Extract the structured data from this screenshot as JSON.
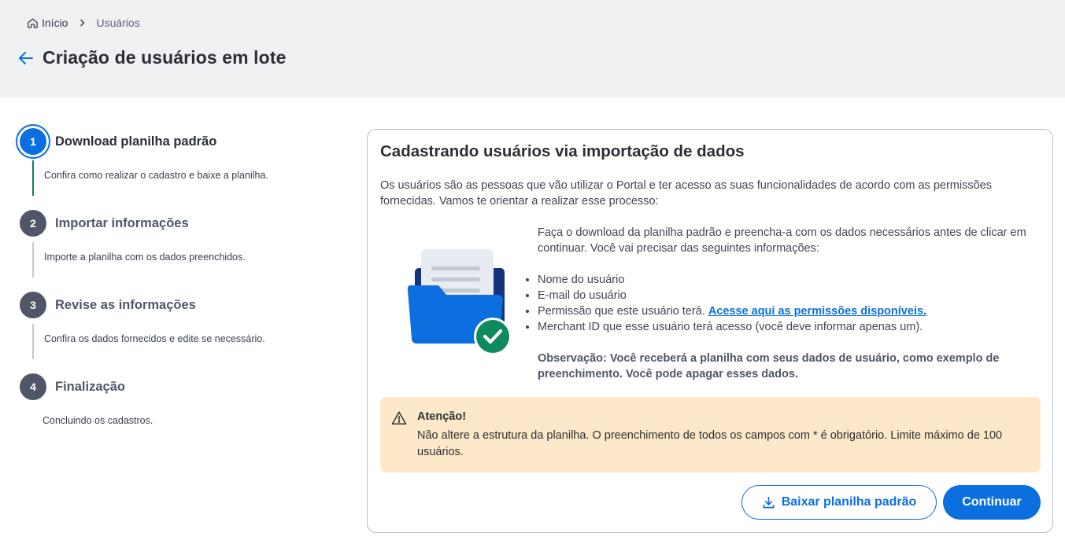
{
  "breadcrumb": {
    "home_label": "Início",
    "current_label": "Usuários"
  },
  "page": {
    "title": "Criação de usuários em lote"
  },
  "stepper": {
    "steps": [
      {
        "number": "1",
        "title": "Download planilha padrão",
        "description": "Confira como realizar o cadastro e baixe a planilha.",
        "state": "active"
      },
      {
        "number": "2",
        "title": "Importar informações",
        "description": "Importe a planilha com os dados preenchidos.",
        "state": "pending"
      },
      {
        "number": "3",
        "title": "Revise as informações",
        "description": "Confira os dados fornecidos e edite se necessário.",
        "state": "pending"
      },
      {
        "number": "4",
        "title": "Finalização",
        "description": "Concluindo os cadastros.",
        "state": "pending"
      }
    ]
  },
  "card": {
    "title": "Cadastrando usuários via importação de dados",
    "description": "Os usuários são as pessoas que vão utilizar o Portal e ter acesso as suas funcionalidades de acordo com as permissões fornecidas. Vamos te orientar a realizar esse processo:",
    "illustration_icon": "folder-document-check-icon",
    "intro": "Faça o download da planilha padrão e preencha-a com os dados necessários antes de clicar em continuar. Você vai precisar das seguintes informações:",
    "items": {
      "name": "Nome do usuário",
      "email": "E-mail do usuário",
      "permission_prefix": "Permissão que este usuário terá.",
      "permission_link": "Acesse aqui as permissões disponíveis.",
      "merchant": "Merchant ID que esse usuário terá acesso (você deve informar apenas um)."
    },
    "observation": "Observação: Você receberá a planilha com seus dados de usuário, como exemplo de preenchimento. Você pode apagar esses dados.",
    "alert": {
      "title": "Atenção!",
      "text": "Não altere a estrutura da planilha. O preenchimento de todos os campos com * é obrigatório. Limite máximo de 100 usuários.",
      "icon": "warning-triangle-icon"
    },
    "buttons": {
      "download_label": "Baixar planilha padrão",
      "continue_label": "Continuar"
    }
  },
  "colors": {
    "primary": "#0b6fe0",
    "success": "#0e8a5f",
    "alert_bg": "#fde8c9",
    "header_bg": "#f0f1f3",
    "step_inactive": "#4f5767"
  }
}
